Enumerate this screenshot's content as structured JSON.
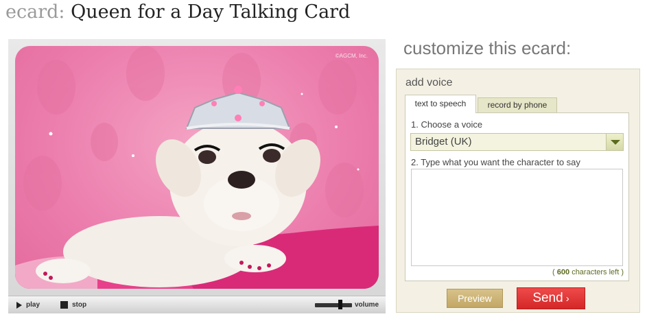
{
  "header": {
    "label": "ecard:",
    "title": "Queen for a Day Talking Card"
  },
  "card": {
    "image_description_icon": "bulldog-puppy-with-tiara",
    "copyright": "©AGCM, Inc.",
    "controls": {
      "play_label": "play",
      "stop_label": "stop",
      "volume_label": "volume"
    }
  },
  "customize": {
    "title": "customize this ecard:",
    "voice_heading": "add voice",
    "tabs": [
      {
        "label": "text to speech",
        "active": true
      },
      {
        "label": "record by phone",
        "active": false
      }
    ],
    "step1_label": "1. Choose a voice",
    "voice_selected": "Bridget (UK)",
    "step2_label": "2. Type what you want the character to say",
    "message_value": "",
    "chars_left_count": "600",
    "chars_left_suffix": "characters left )",
    "chars_left_prefix": "(",
    "preview_label": "Preview",
    "send_label": "Send",
    "send_chevron": "›"
  },
  "colors": {
    "send": "#e03333",
    "preview": "#c9b072",
    "panel": "#f4f1e4",
    "card_pink": "#ec7fae"
  }
}
